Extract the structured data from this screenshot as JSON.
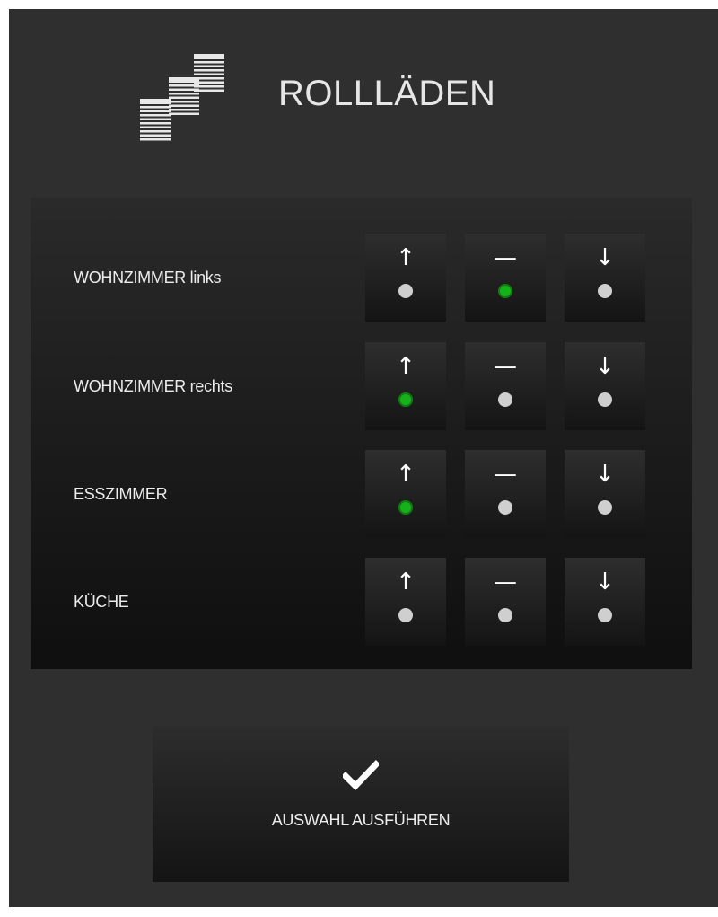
{
  "header": {
    "title": "ROLLLÄDEN",
    "icon": "roller-shutters-icon"
  },
  "controls": {
    "up_glyph": "↑",
    "stop_glyph": "—",
    "down_glyph": "↓"
  },
  "rows": [
    {
      "label": "WOHNZIMMER links",
      "active": "stop"
    },
    {
      "label": "WOHNZIMMER rechts",
      "active": "up"
    },
    {
      "label": "ESSZIMMER",
      "active": "up"
    },
    {
      "label": "KÜCHE",
      "active": "none"
    }
  ],
  "execute": {
    "label": "AUSWAHL AUSFÜHREN",
    "icon": "checkmark-icon"
  },
  "colors": {
    "background": "#2f2f2f",
    "indicator_active": "#17b21b",
    "indicator_inactive": "#cfcfcf",
    "text": "#ececec"
  }
}
